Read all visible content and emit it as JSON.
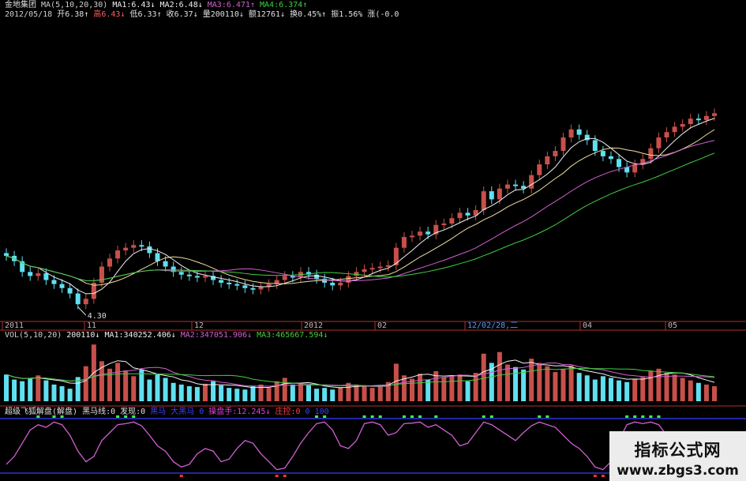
{
  "header": {
    "row1": [
      {
        "text": "金地集团",
        "color": "#e0e0e0"
      },
      {
        "text": " MA(5,10,20,30)",
        "color": "#cfcfcf"
      },
      {
        "text": " MA1:6.43↓",
        "color": "#f0f0f0"
      },
      {
        "text": " MA2:6.48↓",
        "color": "#f0f0f0"
      },
      {
        "text": " MA3:6.471↑",
        "color": "#d060d0"
      },
      {
        "text": " MA4:6.374↑",
        "color": "#40d040"
      }
    ],
    "row2": [
      {
        "text": "2012/05/18",
        "color": "#cfcfcf"
      },
      {
        "text": " 开6.38↑",
        "color": "#e0e0e0"
      },
      {
        "text": " 高6.43↓",
        "color": "#ff6060"
      },
      {
        "text": " 低6.33↑",
        "color": "#e0e0e0"
      },
      {
        "text": " 收6.37↓",
        "color": "#e0e0e0"
      },
      {
        "text": " 量200110↓",
        "color": "#e0e0e0"
      },
      {
        "text": " 额12761↓",
        "color": "#e0e0e0"
      },
      {
        "text": " 换0.45%↑",
        "color": "#e0e0e0"
      },
      {
        "text": " 振1.56%",
        "color": "#e0e0e0"
      },
      {
        "text": " 涨(-0.0",
        "color": "#e0e0e0"
      }
    ]
  },
  "volume_header": [
    {
      "text": "VOL(5,10,20)",
      "color": "#cfcfcf"
    },
    {
      "text": " 200110↓",
      "color": "#f0f0f0"
    },
    {
      "text": " MA1:340252.406↓",
      "color": "#f0f0f0"
    },
    {
      "text": " MA2:347051.906↓",
      "color": "#d060d0"
    },
    {
      "text": " MA3:465667.594↓",
      "color": "#40d040"
    }
  ],
  "indicator_header": [
    {
      "text": "超级飞狐解盘(解盘)",
      "color": "#e0e0e0"
    },
    {
      "text": " 黑马线:0",
      "color": "#e0e0e0"
    },
    {
      "text": " 发现:0",
      "color": "#e0e0e0"
    },
    {
      "text": " 黑马 ",
      "color": "#4040ff"
    },
    {
      "text": " 大黑马 0",
      "color": "#4040ff"
    },
    {
      "text": " 操盘手:12.245↓",
      "color": "#e040e0"
    },
    {
      "text": " 庄控:0",
      "color": "#ff4040"
    },
    {
      "text": " 0 100",
      "color": "#4040ff"
    }
  ],
  "axis_dates": [
    "2011",
    "11",
    "12",
    "2012",
    "02",
    "12/02/28,二",
    "04",
    "05"
  ],
  "annotations": {
    "low_price": "4.30"
  },
  "watermark": {
    "title": "指标公式网",
    "url": "www.zbgs3.com"
  },
  "colors": {
    "up": "#c8504a",
    "down": "#5fe0f0",
    "ma5": "#f0f0f0",
    "ma10": "#f0e0a0",
    "ma20": "#d060d0",
    "ma30": "#40d040",
    "panel_line": "#b03030",
    "indicator": "#d060d0",
    "blue_line": "#3040ff"
  },
  "chart_data": {
    "type": "candlestick",
    "close": [
      6.2,
      6.0,
      5.6,
      5.45,
      5.55,
      5.3,
      5.15,
      5.0,
      4.8,
      4.4,
      4.6,
      5.2,
      5.8,
      6.1,
      6.4,
      6.5,
      6.6,
      6.55,
      6.3,
      6.0,
      5.8,
      5.6,
      5.5,
      5.45,
      5.4,
      5.45,
      5.3,
      5.2,
      5.15,
      5.1,
      5.0,
      4.95,
      5.05,
      5.15,
      5.3,
      5.45,
      5.4,
      5.6,
      5.5,
      5.35,
      5.2,
      5.1,
      5.2,
      5.45,
      5.6,
      5.7,
      5.75,
      5.8,
      5.85,
      6.5,
      6.9,
      6.95,
      7.1,
      7.0,
      7.35,
      7.4,
      7.6,
      7.8,
      7.7,
      7.9,
      8.6,
      8.3,
      8.7,
      8.85,
      8.8,
      8.7,
      9.2,
      9.6,
      9.9,
      10.1,
      10.6,
      10.9,
      10.7,
      10.5,
      10.1,
      9.9,
      9.8,
      9.5,
      9.3,
      9.6,
      9.8,
      10.2,
      10.6,
      10.8,
      11.0,
      11.1,
      11.3,
      11.25,
      11.4,
      11.5
    ],
    "volume": [
      3.2,
      2.6,
      2.4,
      2.8,
      3.1,
      2.5,
      2.0,
      1.8,
      1.5,
      2.9,
      4.2,
      6.8,
      4.8,
      3.9,
      4.6,
      3.7,
      3.0,
      3.8,
      2.6,
      3.2,
      2.8,
      2.2,
      2.0,
      1.8,
      1.7,
      2.1,
      2.4,
      1.9,
      1.6,
      1.5,
      1.4,
      1.8,
      2.0,
      1.6,
      2.4,
      2.8,
      2.0,
      2.1,
      1.9,
      1.5,
      1.6,
      1.4,
      1.7,
      2.2,
      2.0,
      1.8,
      1.6,
      1.9,
      2.3,
      4.5,
      3.1,
      2.7,
      3.3,
      2.6,
      3.6,
      2.9,
      3.0,
      3.2,
      2.4,
      3.4,
      5.7,
      4.6,
      5.9,
      4.4,
      4.1,
      3.8,
      5.1,
      4.6,
      4.2,
      3.5,
      3.9,
      4.3,
      3.4,
      3.1,
      2.6,
      3.0,
      2.8,
      2.5,
      2.3,
      2.7,
      2.9,
      3.6,
      3.9,
      3.4,
      3.2,
      2.8,
      2.5,
      2.2,
      2.0,
      1.8
    ],
    "indicator": [
      15,
      30,
      55,
      80,
      90,
      85,
      95,
      90,
      70,
      40,
      20,
      30,
      60,
      75,
      90,
      92,
      95,
      88,
      70,
      50,
      40,
      20,
      10,
      15,
      35,
      45,
      40,
      20,
      25,
      45,
      60,
      55,
      35,
      20,
      5,
      8,
      30,
      55,
      75,
      92,
      95,
      80,
      50,
      45,
      60,
      92,
      95,
      90,
      70,
      75,
      92,
      93,
      95,
      85,
      90,
      80,
      70,
      50,
      55,
      75,
      95,
      90,
      80,
      70,
      60,
      75,
      88,
      95,
      90,
      85,
      70,
      55,
      45,
      30,
      10,
      5,
      20,
      60,
      90,
      95,
      92,
      95,
      90,
      70,
      50,
      45,
      30,
      15,
      5,
      8
    ],
    "low_label": "4.30"
  }
}
